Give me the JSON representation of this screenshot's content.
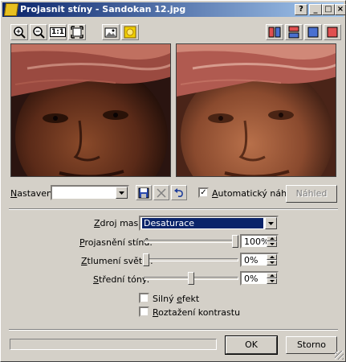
{
  "window": {
    "title": "Projasnit stíny - Sandokan 12.jpg",
    "controls": {
      "help": "?",
      "minimize": "_",
      "maximize": "□",
      "close": "×"
    }
  },
  "toolbar": {
    "left_tools": [
      "zoom-in-icon",
      "zoom-out-icon",
      "actual-size-icon",
      "fit-window-icon"
    ],
    "actual_size_label": "1:1",
    "middle_tools": [
      "show-original-icon",
      "show-preview-icon"
    ],
    "right_tools": [
      "split-vertical-icon",
      "split-horizontal-icon",
      "single-view-icon",
      "original-only-icon"
    ]
  },
  "settings": {
    "label_pre": "N",
    "label_rest": "astavení:",
    "value": "",
    "auto_preview_label_pre": "A",
    "auto_preview_label_rest": "utomatický náhled",
    "auto_preview_checked": true,
    "preview_button_label": "Náhled"
  },
  "mask_source": {
    "label_pre": "Z",
    "label_rest": "droj masky:",
    "value": "Desaturace"
  },
  "shadow_brightening": {
    "label_pre": "P",
    "label_rest": "rojasnění stínů:",
    "value": "100%",
    "level": 100
  },
  "highlight_dimming": {
    "label_pre": "Z",
    "label_rest": "tlumení světel:",
    "value": "0%",
    "level": 0
  },
  "midtones": {
    "label_pre": "S",
    "label_rest": "třední tóny:",
    "value": "0%",
    "level": 0
  },
  "strong_effect": {
    "label_pre": "Silný ",
    "label_u": "e",
    "label_rest": "fekt",
    "checked": false
  },
  "contrast_stretch": {
    "label_pre": "",
    "label_u": "R",
    "label_rest": "oztažení kontrastu",
    "checked": false
  },
  "footer": {
    "progress": 0,
    "ok_label": "OK",
    "cancel_label": "Storno"
  }
}
